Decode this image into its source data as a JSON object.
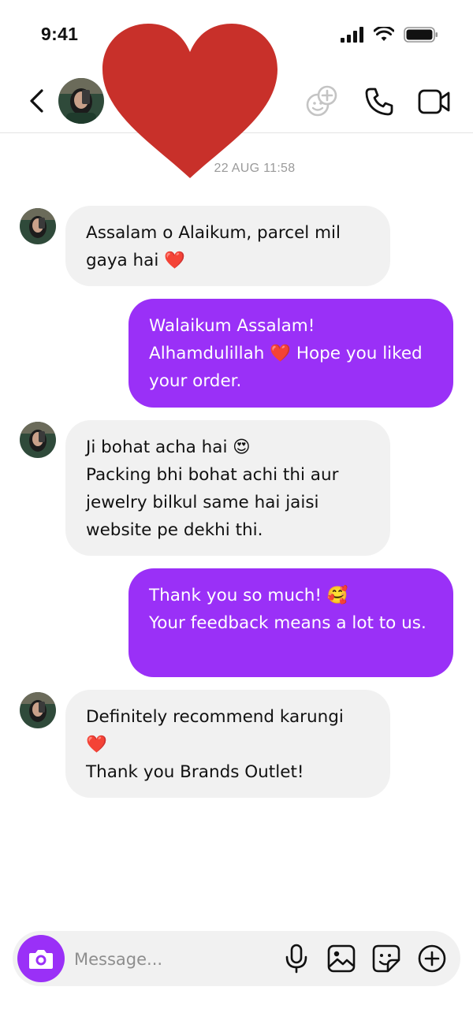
{
  "status_bar": {
    "time": "9:41",
    "icons": [
      "signal-icon",
      "wifi-icon",
      "battery-icon"
    ]
  },
  "header": {
    "icons": [
      "back-chevron-icon",
      "avatar",
      "video-effects-icon",
      "phone-icon",
      "video-camera-icon"
    ],
    "overlay": "red-heart-icon"
  },
  "thread": {
    "date_separator": "22 AUG 11:58"
  },
  "messages": [
    {
      "side": "received",
      "text": "Assalam o Alaikum, parcel mil\ngaya hai ❤️"
    },
    {
      "side": "sent",
      "text": "Walaikum Assalam!\nAlhamdulillah ❤️ Hope you liked\nyour order."
    },
    {
      "side": "received",
      "text": "Ji bohat acha hai 😍\nPacking bhi bohat achi thi aur\njewelry bilkul same hai jaisi\nwebsite pe dekhi thi."
    },
    {
      "side": "sent",
      "text": "Thank you so much! 🥰\nYour feedback means a lot to us."
    },
    {
      "side": "received",
      "text": "Definitely recommend karungi\n❤️\nThank you Brands Outlet!"
    }
  ],
  "composer": {
    "placeholder": "Message...",
    "icons": [
      "camera-icon",
      "microphone-icon",
      "gallery-icon",
      "sticker-icon",
      "plus-circle-icon"
    ]
  },
  "colors": {
    "sent_bubble": "#9a30f7",
    "received_bubble": "#f1f1f1",
    "heart": "#c8302a",
    "timestamp": "#9a9a9a"
  }
}
